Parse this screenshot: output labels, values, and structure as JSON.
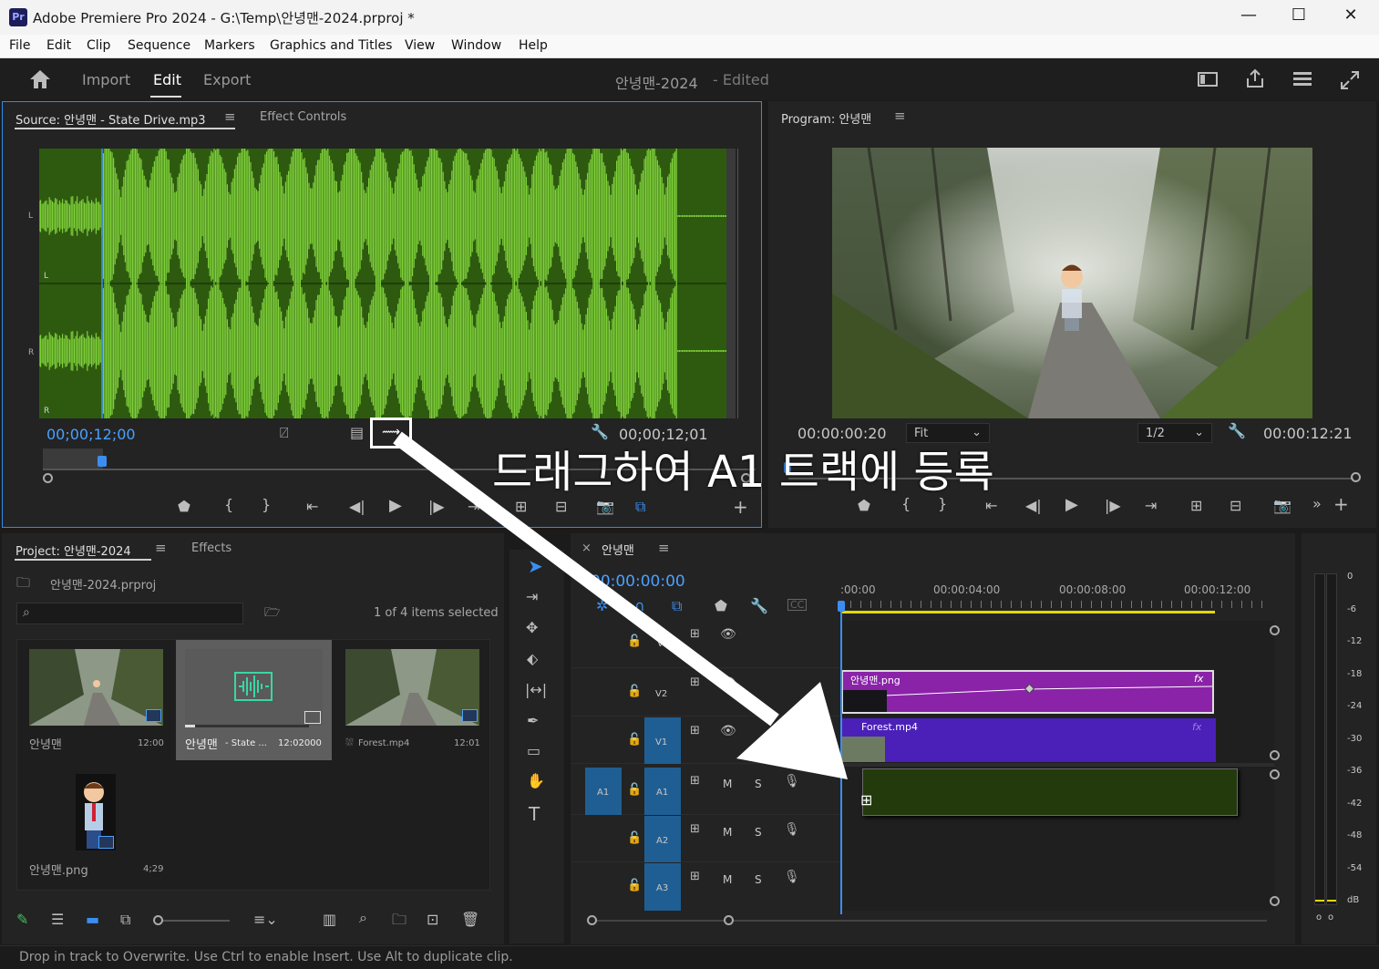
{
  "window": {
    "app_icon": "Pr",
    "title": "Adobe Premiere Pro 2024 - G:\\Temp\\안녕맨-2024.prproj *",
    "minimize": "—",
    "maximize": "☐",
    "close": "✕"
  },
  "menu": [
    "File",
    "Edit",
    "Clip",
    "Sequence",
    "Markers",
    "Graphics and Titles",
    "View",
    "Window",
    "Help"
  ],
  "header": {
    "import": "Import",
    "edit": "Edit",
    "export": "Export",
    "project_title": "안녕맨-2024",
    "edited": "- Edited"
  },
  "source": {
    "tab_label": "Source: 안녕맨 - State Drive.mp3",
    "effect_controls": "Effect Controls",
    "channel_l": "L",
    "channel_r": "R",
    "timecode_in": "00;00;12;00",
    "timecode_out": "00;00;12;01",
    "colors": {
      "waveform_bg": "#2e5a10",
      "waveform": "#7ed03a"
    }
  },
  "program": {
    "tab_label": "Program: 안녕맨",
    "timecode_in": "00:00:00:20",
    "fit": "Fit",
    "resolution": "1/2",
    "timecode_out": "00:00:12:21"
  },
  "annotation": "드래그하여 A1 트랙에 등록",
  "project": {
    "tab_label": "Project: 안녕맨-2024",
    "effects_tab": "Effects",
    "file": "안녕맨-2024.prproj",
    "items_selected": "1 of 4 items selected",
    "search_placeholder": "",
    "items": [
      {
        "name": "안녕맨",
        "duration": "12:00"
      },
      {
        "name": "안녕맨",
        "subname": "- State ...",
        "duration": "12:02000"
      },
      {
        "name": "Forest.mp4",
        "duration": "12:01"
      },
      {
        "name": "안녕맨.png",
        "duration": "4;29"
      }
    ]
  },
  "timeline": {
    "tab_label": "안녕맨",
    "close": "×",
    "timecode": "00:00:00:00",
    "ruler": [
      ":00:00",
      "00:00:04:00",
      "00:00:08:00",
      "00:00:12:00"
    ],
    "tracks_video": [
      "V3",
      "V2",
      "V1"
    ],
    "tracks_audio": [
      "A1",
      "A2",
      "A3"
    ],
    "source_patch_audio": "A1",
    "mute": "M",
    "solo": "S",
    "clips": {
      "v2": "안녕맨.png",
      "v1": "Forest.mp4",
      "fx": "fx"
    },
    "colors": {
      "v2": "#8a23a8",
      "v1": "#4a20b8",
      "a1": "#223a0c",
      "playhead": "#3b8ef0",
      "workarea": "#e6d800"
    }
  },
  "meter": {
    "scale": [
      "0",
      "-6",
      "-12",
      "-18",
      "-24",
      "-30",
      "-36",
      "-42",
      "-48",
      "-54",
      "dB"
    ],
    "solo_buttons": [
      "S",
      "S"
    ]
  },
  "status": "Drop in track to Overwrite. Use Ctrl to enable Insert. Use Alt to duplicate clip."
}
